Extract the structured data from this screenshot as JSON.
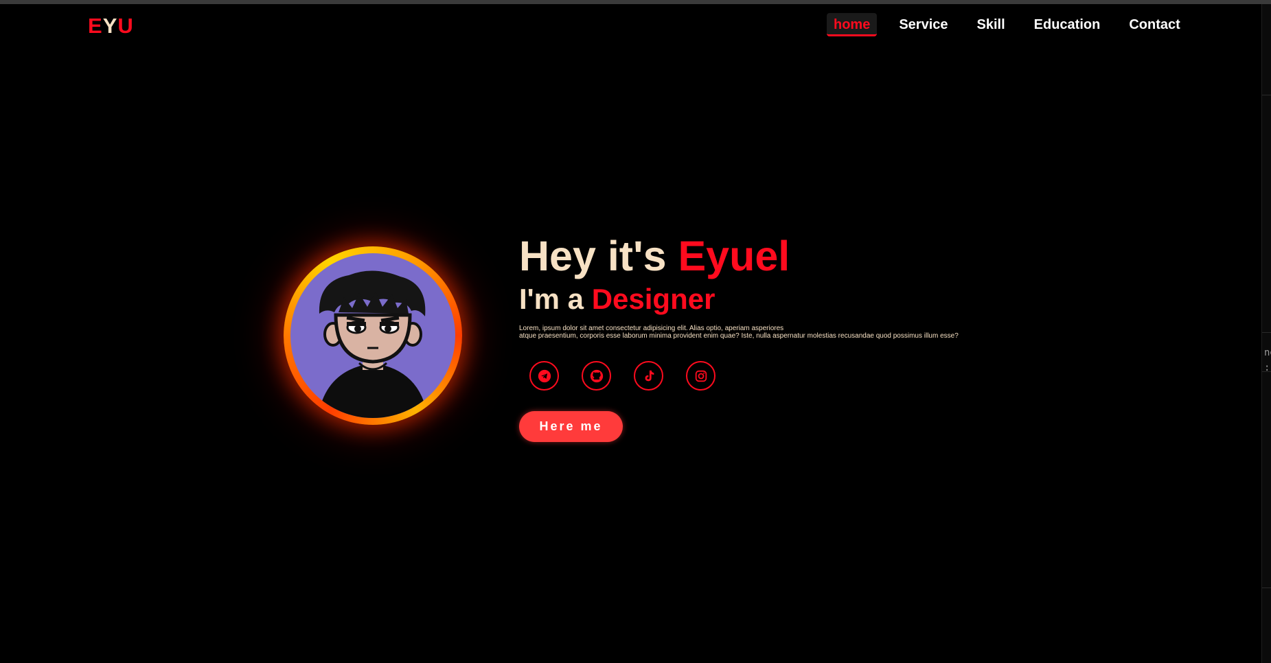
{
  "logo": {
    "part1": "E",
    "part2": "Y",
    "part3": "U"
  },
  "nav": {
    "items": [
      {
        "label": "home",
        "active": true
      },
      {
        "label": "Service"
      },
      {
        "label": "Skill"
      },
      {
        "label": "Education"
      },
      {
        "label": "Contact"
      }
    ]
  },
  "hero": {
    "greeting": "Hey it's ",
    "name": "Eyuel",
    "role_prefix": "I'm a ",
    "role": "Designer",
    "description_line1": "Lorem, ipsum dolor sit amet consectetur adipisicing elit. Alias optio, aperiam asperiores",
    "description_line2": "atque praesentium, corporis esse laborum minima provident enim quae? Iste, nulla aspernatur molestias recusandae quod possimus illum esse?",
    "cta_label": "Here me"
  },
  "socials": [
    {
      "icon": "telegram-icon"
    },
    {
      "icon": "github-icon"
    },
    {
      "icon": "tiktok-icon"
    },
    {
      "icon": "instagram-icon"
    }
  ],
  "colors": {
    "background": "#000000",
    "accent": "#ff0b1e",
    "text": "#f7e1c4",
    "button": "#ff3b3b",
    "avatar_bg": "#7b6ccb"
  },
  "right_panel": {
    "text1": "ne",
    "text2": ":"
  }
}
